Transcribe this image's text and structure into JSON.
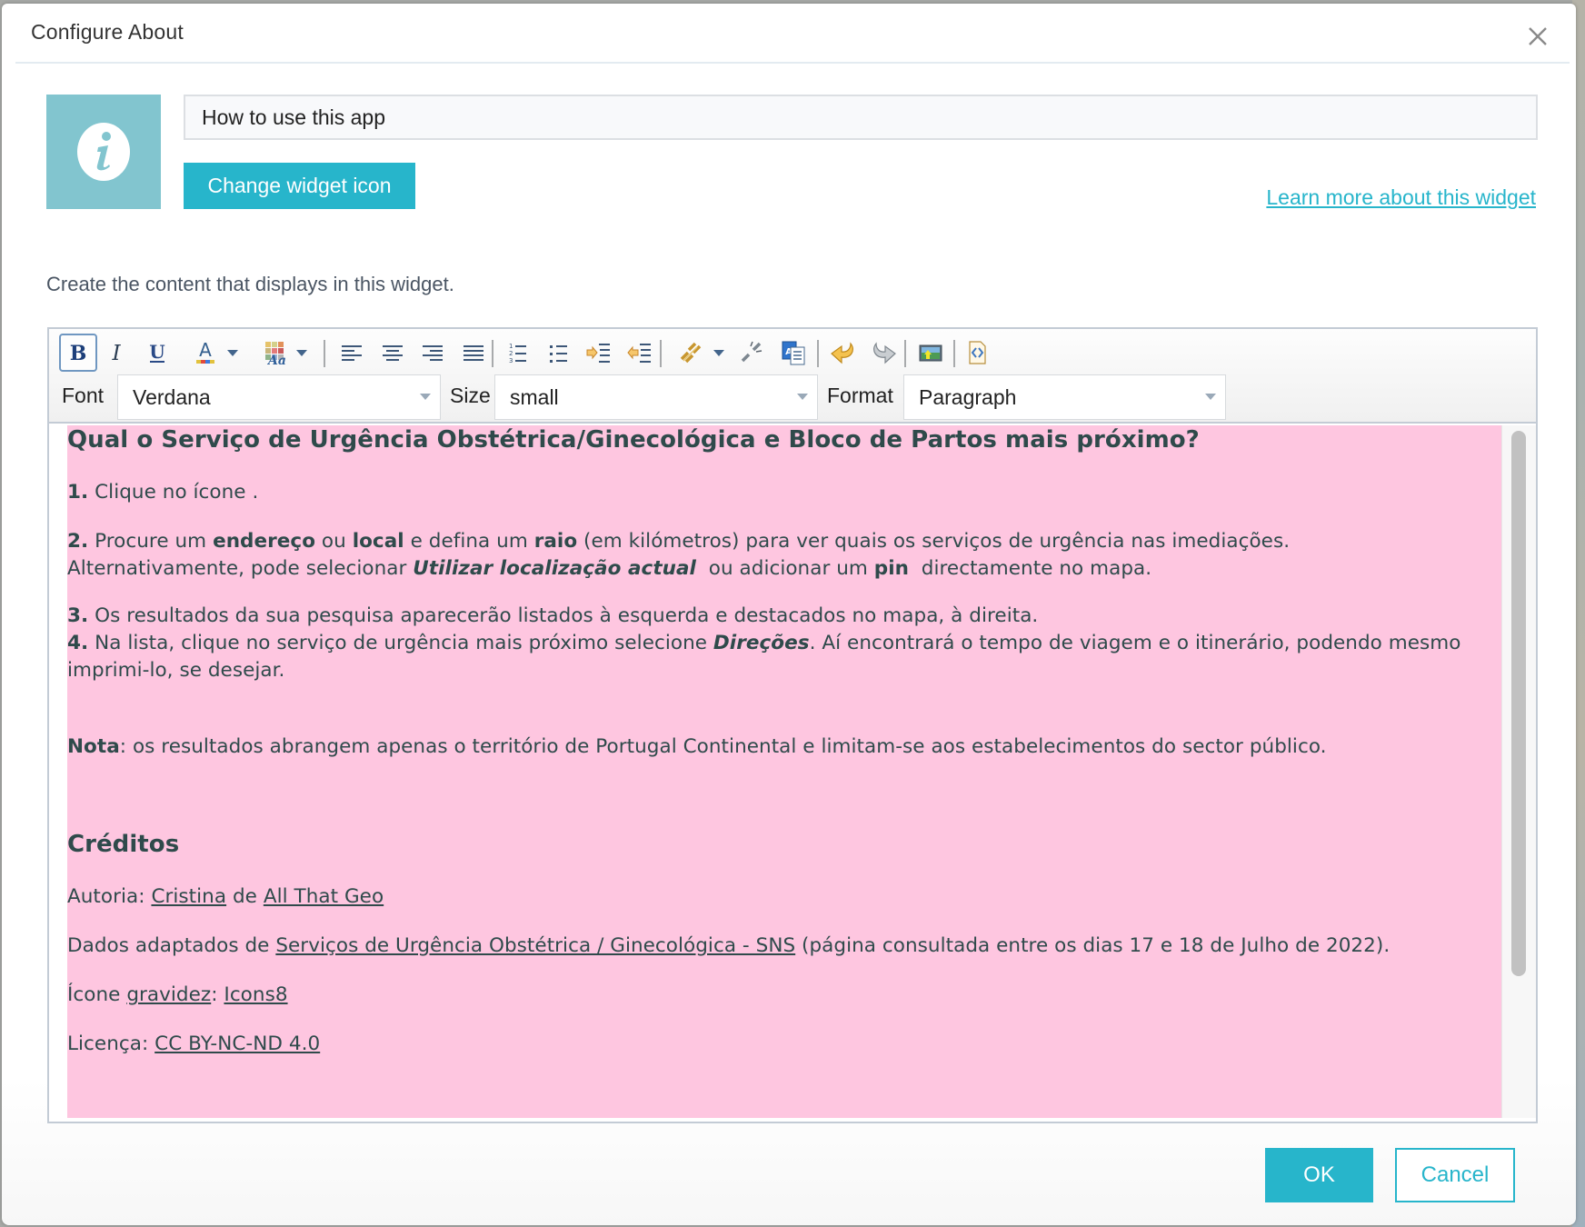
{
  "dialog": {
    "title": "Configure About",
    "close_icon": "close-icon"
  },
  "widget": {
    "icon": "info-icon",
    "icon_bg_color": "#82c5cf",
    "title_value": "How to use this app",
    "change_icon_label": "Change widget icon",
    "learn_more_label": "Learn more about this widget",
    "instructions": "Create the content that displays in this widget."
  },
  "toolbar": {
    "buttons": [
      {
        "name": "bold",
        "icon": "bold-icon",
        "active": true
      },
      {
        "name": "italic",
        "icon": "italic-icon"
      },
      {
        "name": "underline",
        "icon": "underline-icon"
      },
      {
        "name": "font-color",
        "icon": "font-color-icon",
        "dropdown": true
      },
      {
        "name": "highlight-color",
        "icon": "highlight-color-icon",
        "dropdown": true
      },
      {
        "name": "align-left",
        "icon": "align-left-icon"
      },
      {
        "name": "align-center",
        "icon": "align-center-icon"
      },
      {
        "name": "align-right",
        "icon": "align-right-icon"
      },
      {
        "name": "align-justify",
        "icon": "align-justify-icon"
      },
      {
        "name": "ordered-list",
        "icon": "ordered-list-icon"
      },
      {
        "name": "unordered-list",
        "icon": "unordered-list-icon"
      },
      {
        "name": "indent",
        "icon": "indent-icon"
      },
      {
        "name": "outdent",
        "icon": "outdent-icon"
      },
      {
        "name": "link",
        "icon": "link-icon",
        "dropdown": true
      },
      {
        "name": "unlink",
        "icon": "unlink-icon"
      },
      {
        "name": "paste-from-word",
        "icon": "paste-word-icon"
      },
      {
        "name": "undo",
        "icon": "undo-icon"
      },
      {
        "name": "redo",
        "icon": "redo-icon"
      },
      {
        "name": "insert-image",
        "icon": "image-icon"
      },
      {
        "name": "view-source",
        "icon": "source-icon"
      }
    ],
    "font_label": "Font",
    "font_value": "Verdana",
    "size_label": "Size",
    "size_value": "small",
    "format_label": "Format",
    "format_value": "Paragraph"
  },
  "content": {
    "background_color": "#fec6e0",
    "text_color": "#2f4a4b",
    "heading": "Qual o Serviço de Urgência Obstétrica/Ginecológica e Bloco de Partos mais próximo?",
    "step1": {
      "num": "1.",
      "text": " Clique no ícone ."
    },
    "step2": {
      "num": "2.",
      "t1": " Procure um ",
      "b1": "endereço",
      "t2": " ou ",
      "b2": "local",
      "t3": " e defina um ",
      "b3": "raio",
      "t4": " (em kilómetros) para ver quais os serviços de urgência nas imediações.",
      "t5": "Alternativamente, pode selecionar ",
      "bi1": "Utilizar localização actual",
      "t6": "  ou adicionar um ",
      "b4": "pin",
      "t7": "  directamente no mapa."
    },
    "step3": {
      "num": "3.",
      "text": " Os resultados da sua pesquisa aparecerão listados à esquerda e destacados no mapa, à direita."
    },
    "step4": {
      "num": "4.",
      "t1": " Na lista, clique no serviço de urgência mais próximo selecione ",
      "bi1": "Direções",
      "t2": ". Aí encontrará o tempo de viagem e o itinerário, podendo mesmo",
      "t3": "imprimi-lo, se desejar."
    },
    "note": {
      "label": "Nota",
      "text": ": os resultados abrangem apenas o território de Portugal Continental e limitam-se aos estabelecimentos do sector público."
    },
    "credits_heading": "Créditos",
    "authorship": {
      "label": "Autoria: ",
      "link1": "Cristina",
      "mid": " de ",
      "link2": "All That Geo"
    },
    "data_source": {
      "label": "Dados adaptados de ",
      "link": "Serviços de Urgência Obstétrica / Ginecológica - SNS",
      "tail": " (página consultada entre os dias 17 e 18 de Julho de 2022)."
    },
    "icon_credit": {
      "label": "Ícone ",
      "link1": "gravidez",
      "mid": ": ",
      "link2": "Icons8"
    },
    "license": {
      "label": "Licença: ",
      "link": "CC BY-NC-ND 4.0"
    }
  },
  "footer": {
    "ok_label": "OK",
    "cancel_label": "Cancel",
    "accent_color": "#27b5cb"
  }
}
